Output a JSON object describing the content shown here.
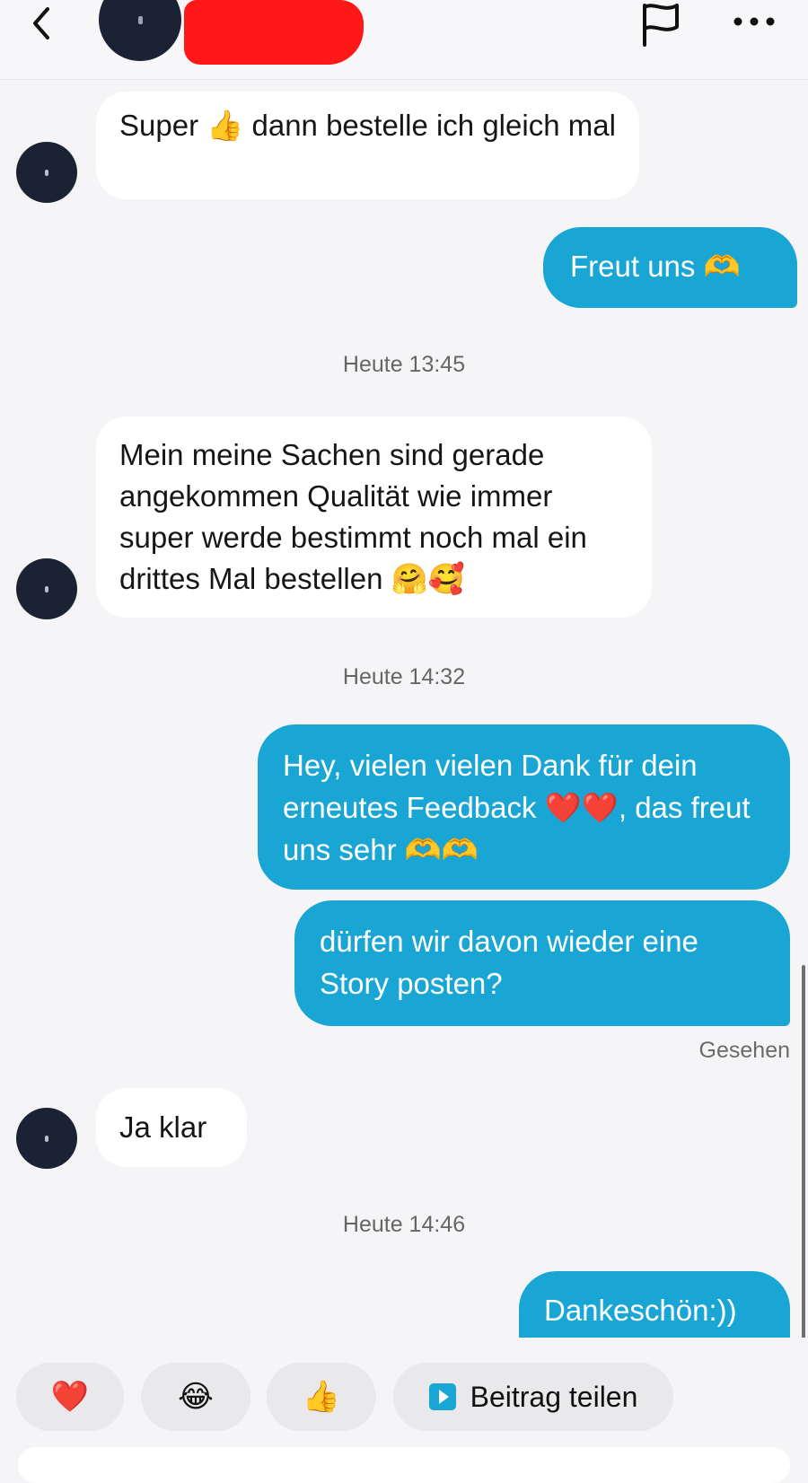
{
  "header": {
    "contact_name": "",
    "back_icon": "chevron-left-icon",
    "flag_icon": "flag-icon",
    "more_icon": "more-horizontal-icon"
  },
  "messages": [
    {
      "side": "in",
      "text": "Super 👍 dann bestelle ich gleich mal"
    },
    {
      "side": "out",
      "text": "Freut uns 🫶"
    },
    {
      "type": "time",
      "text": "Heute 13:45"
    },
    {
      "side": "in",
      "text": "Mein meine Sachen sind gerade angekommen Qualität wie immer super werde bestimmt noch mal ein drittes Mal bestellen 🤗🥰"
    },
    {
      "type": "time",
      "text": "Heute 14:32"
    },
    {
      "side": "out",
      "text": "Hey, vielen vielen Dank für dein erneutes Feedback ❤️❤️, das freut uns sehr 🫶🫶"
    },
    {
      "side": "out",
      "text": "dürfen wir davon wieder eine Story posten?"
    },
    {
      "type": "status",
      "text": "Gesehen"
    },
    {
      "side": "in",
      "text": "Ja klar"
    },
    {
      "type": "time",
      "text": "Heute 14:46"
    },
    {
      "side": "out",
      "text": "Dankeschön:))"
    }
  ],
  "quick_reactions": {
    "heart": "❤️",
    "laugh": "😂",
    "thumbs_up": "👍",
    "share_label": "Beitrag teilen"
  },
  "colors": {
    "outgoing_bubble": "#1aa6d4",
    "incoming_bubble": "#ffffff",
    "background": "#f5f5f7"
  }
}
